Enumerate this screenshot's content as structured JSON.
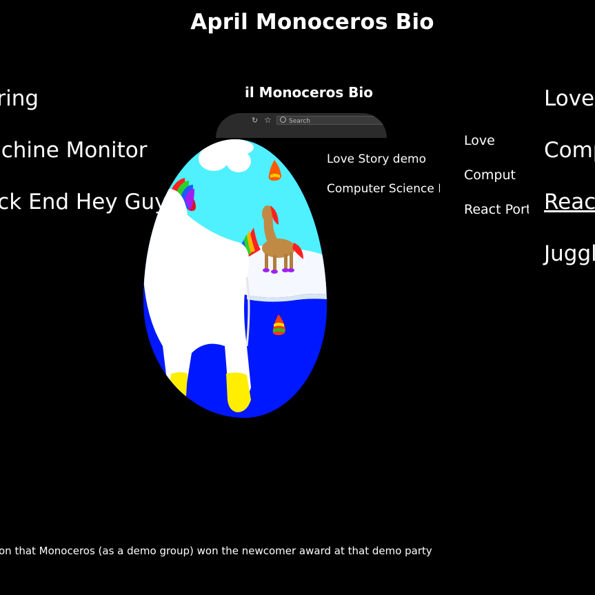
{
  "page": {
    "title": "April Monoceros Bio"
  },
  "left_list": {
    "items": [
      {
        "label": "Spring"
      },
      {
        "label": "Machine Monitor"
      },
      {
        "label": "Back End Hey Guys"
      }
    ]
  },
  "right_list": {
    "items": [
      {
        "label": "Love"
      },
      {
        "label": "Comp"
      },
      {
        "label": "React"
      },
      {
        "label": "Juggl"
      }
    ]
  },
  "nested_page": {
    "title": "il Monoceros Bio",
    "browser_bar": {
      "search_placeholder": "Search",
      "star_icon": "star-icon",
      "search_icon": "search-icon"
    },
    "mid_items": [
      {
        "label": "Love Story demo"
      },
      {
        "label": "Computer Science M"
      }
    ],
    "right_items": [
      {
        "label": "Love"
      },
      {
        "label": "Comput"
      },
      {
        "label": "React Port"
      }
    ]
  },
  "footer": {
    "text": "very reason that Monoceros (as a demo group) won the newcomer award at that demo party"
  },
  "colors": {
    "background": "#000000",
    "text": "#ffffff",
    "sky": "#4ff0ff",
    "water": "#0018ff",
    "unicorn": "#ffffff",
    "hooves": "#ffee00"
  }
}
